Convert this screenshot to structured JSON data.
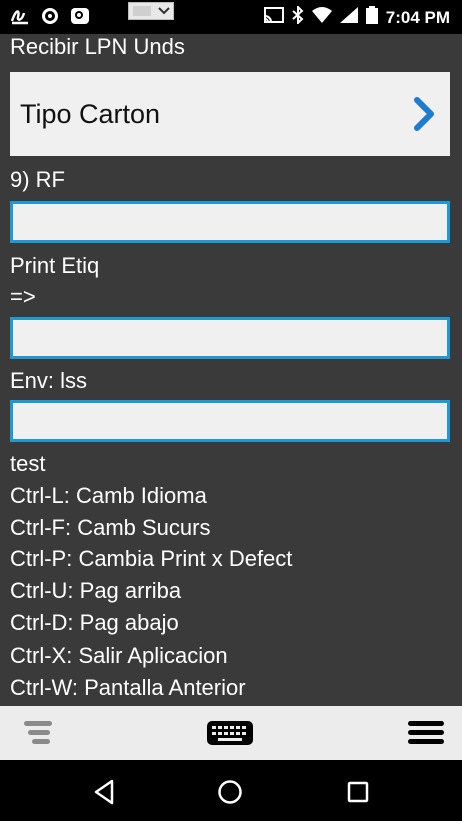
{
  "status_bar": {
    "time": "7:04 PM",
    "left_icons": [
      "signature-icon",
      "eye-icon",
      "remote-icon",
      "screen-preview-icon"
    ],
    "right_icons": [
      "cast-icon",
      "bluetooth-icon",
      "wifi-icon",
      "signal-icon",
      "battery-icon"
    ]
  },
  "screen": {
    "title": "Recibir LPN Unds",
    "menu_item": {
      "label": "Tipo Carton",
      "icon": "chevron-right-icon",
      "icon_color": "#1d7bd1"
    },
    "field1_label": "9) RF",
    "field1_value": "",
    "print_label": "Print Etiq",
    "arrow_label": "=>",
    "field2_value": "",
    "env_label": "Env: lss",
    "field3_value": "",
    "test_label": "test",
    "shortcuts": [
      "Ctrl-L: Camb Idioma",
      "Ctrl-F: Camb Sucurs",
      "Ctrl-P: Cambia Print x Defect",
      "Ctrl-U: Pag arriba",
      "Ctrl-D: Pag abajo",
      "Ctrl-X: Salir Aplicacion",
      "Ctrl-W: Pantalla Anterior"
    ]
  },
  "toolbar": {
    "icons": [
      "filter-menu-icon",
      "keyboard-icon",
      "hamburger-menu-icon"
    ]
  },
  "nav": {
    "icons": [
      "back-icon",
      "home-icon",
      "recents-icon"
    ]
  },
  "colors": {
    "background": "#3a3a3a",
    "field_border": "#1d9ad6",
    "field_bg": "#f0f0f0"
  }
}
